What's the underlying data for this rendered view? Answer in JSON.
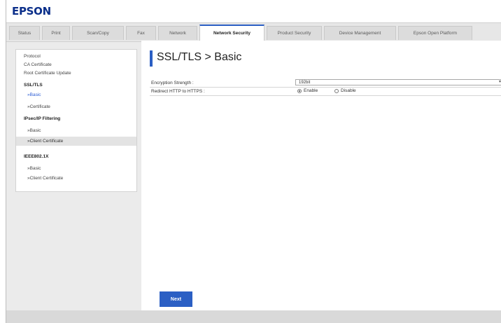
{
  "header": {
    "logo_text": "EPSON"
  },
  "tabs": [
    {
      "label": "Status",
      "active": false
    },
    {
      "label": "Print",
      "active": false
    },
    {
      "label": "Scan/Copy",
      "active": false
    },
    {
      "label": "Fax",
      "active": false
    },
    {
      "label": "Network",
      "active": false
    },
    {
      "label": "Network Security",
      "active": true
    },
    {
      "label": "Product Security",
      "active": false
    },
    {
      "label": "Device Management",
      "active": false
    },
    {
      "label": "Epson Open Platform",
      "active": false
    }
  ],
  "sidebar": {
    "items": [
      {
        "label": "Protocol",
        "type": "plain"
      },
      {
        "label": "CA Certificate",
        "type": "plain"
      },
      {
        "label": "Root Certificate Update",
        "type": "plain"
      },
      {
        "label": "SSL/TLS",
        "type": "head"
      },
      {
        "label": "»Basic",
        "type": "link"
      },
      {
        "label": "»Certificate",
        "type": "plain"
      },
      {
        "label": "IPsec/IP Filtering",
        "type": "head"
      },
      {
        "label": "»Basic",
        "type": "plain"
      },
      {
        "label": "»Client Certificate",
        "type": "selected"
      },
      {
        "label": "IEEE802.1X",
        "type": "head"
      },
      {
        "label": "»Basic",
        "type": "plain"
      },
      {
        "label": "»Client Certificate",
        "type": "plain"
      }
    ]
  },
  "main": {
    "title": "SSL/TLS > Basic",
    "encryption": {
      "label": "Encryption Strength :",
      "value": "192bit"
    },
    "redirect": {
      "label": "Redirect HTTP to HTTPS :",
      "options": [
        {
          "label": "Enable",
          "selected": true
        },
        {
          "label": "Disable",
          "selected": false
        }
      ]
    },
    "next_label": "Next"
  },
  "colors": {
    "brand": "#0b2f8a",
    "accent": "#2b5fc4",
    "link": "#2a5bd4"
  },
  "icons": {
    "select_chevron": "chevron-down-icon"
  }
}
